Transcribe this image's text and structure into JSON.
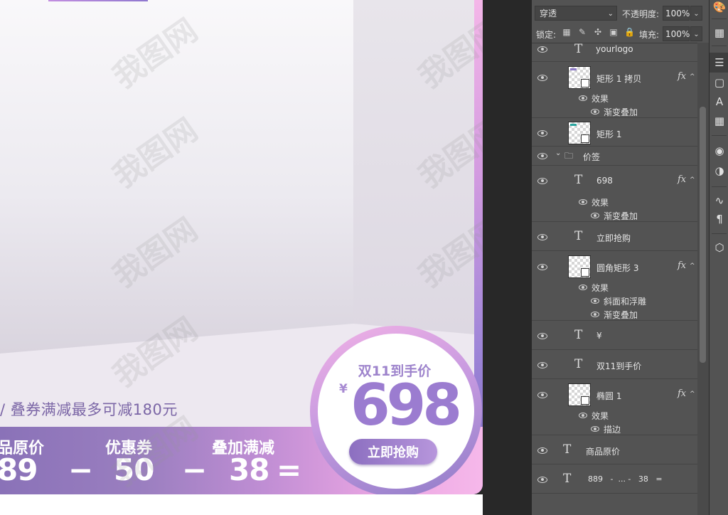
{
  "canvas": {
    "subtitle": "/ 叠券满减最多可减180元",
    "band": {
      "labels": [
        "品原价",
        "优惠券",
        "叠加满减"
      ],
      "numbers": [
        "89",
        "50",
        "38"
      ],
      "ops": [
        "−",
        "−",
        "="
      ]
    },
    "badge": {
      "title": "双11到手价",
      "currency": "¥",
      "price": "698",
      "button": "立即抢购"
    },
    "watermark": "我图网"
  },
  "layers_panel": {
    "blend_mode": "穿透",
    "opacity_label": "不透明度:",
    "opacity_value": "100%",
    "lock_label": "锁定:",
    "fill_label": "填充:",
    "fill_value": "100%",
    "effects_label": "效果",
    "layers": [
      {
        "name": "yourlogo",
        "kind": "text"
      },
      {
        "name": "矩形 1 拷贝",
        "kind": "shape",
        "fx": true,
        "effects": [
          "渐变叠加"
        ]
      },
      {
        "name": "矩形 1",
        "kind": "shape"
      },
      {
        "name": "价签",
        "kind": "group"
      },
      {
        "name": "698",
        "kind": "text",
        "fx": true,
        "effects": [
          "渐变叠加"
        ]
      },
      {
        "name": "立即抢购",
        "kind": "text"
      },
      {
        "name": "圆角矩形 3",
        "kind": "shape",
        "fx": true,
        "effects": [
          "斜面和浮雕",
          "渐变叠加"
        ]
      },
      {
        "name": "¥",
        "kind": "text"
      },
      {
        "name": "双11到手价",
        "kind": "text"
      },
      {
        "name": "椭圆 1",
        "kind": "shape",
        "fx": true,
        "effects": [
          "描边"
        ]
      },
      {
        "name": "商品原价",
        "kind": "text"
      },
      {
        "name": "889   -  ... -   38   =",
        "kind": "text"
      }
    ],
    "fx_symbol": "fx"
  },
  "colors": {
    "accent_purple": "#9b7cd0",
    "accent_pink": "#f2b2e6",
    "panel_bg": "#535353"
  }
}
